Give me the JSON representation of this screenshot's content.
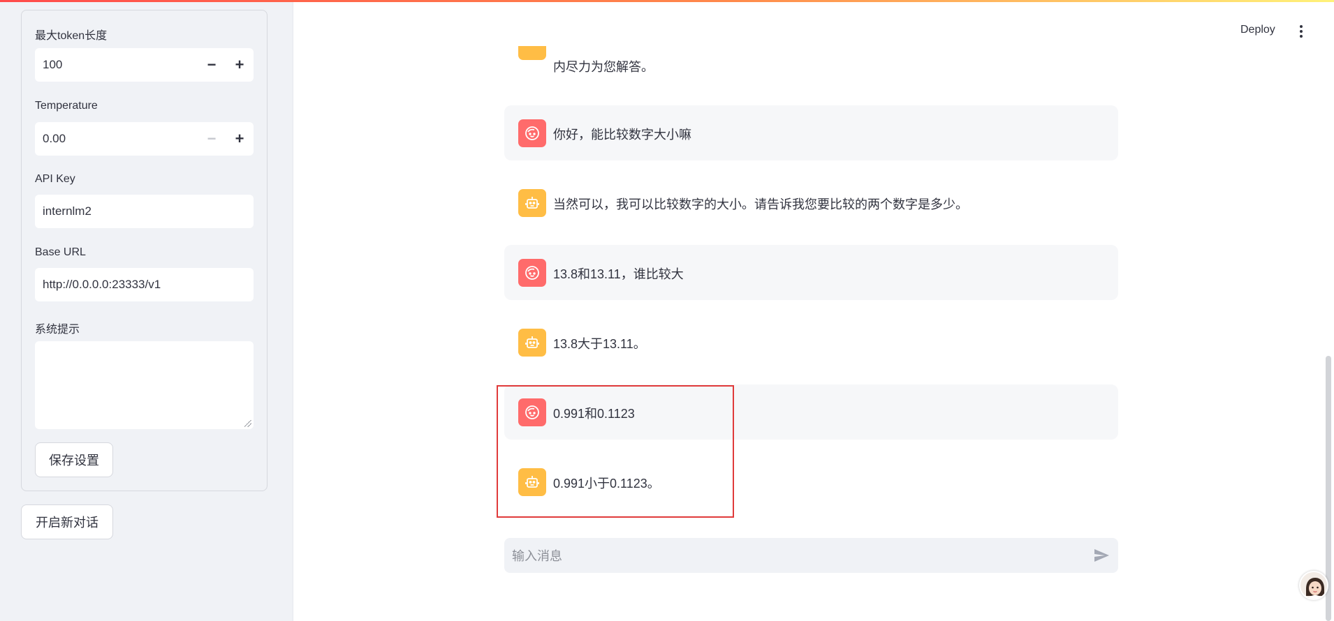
{
  "header": {
    "deploy_label": "Deploy",
    "menu_icon": "kebab-menu-icon"
  },
  "sidebar": {
    "max_tokens": {
      "label": "最大token长度",
      "value": "100"
    },
    "temperature": {
      "label": "Temperature",
      "value": "0.00"
    },
    "api_key": {
      "label": "API Key",
      "value": "internlm2"
    },
    "base_url": {
      "label": "Base URL",
      "value": "http://0.0.0.0:23333/v1"
    },
    "system_prompt": {
      "label": "系统提示",
      "value": ""
    },
    "save_button": "保存设置",
    "new_chat_button": "开启新对话",
    "minus_glyph": "−",
    "plus_glyph": "+"
  },
  "chat": {
    "partial_message": "内尽力为您解答。",
    "messages": [
      {
        "role": "user",
        "text": "你好，能比较数字大小嘛"
      },
      {
        "role": "assistant",
        "text": "当然可以，我可以比较数字的大小。请告诉我您要比较的两个数字是多少。"
      },
      {
        "role": "user",
        "text": "13.8和13.11，谁比较大"
      },
      {
        "role": "assistant",
        "text": "13.8大于13.11。"
      },
      {
        "role": "user",
        "text": "0.991和0.1123"
      },
      {
        "role": "assistant",
        "text": "0.991小于0.1123。"
      }
    ],
    "input_placeholder": "输入消息"
  },
  "colors": {
    "user_avatar": "#ff6b6b",
    "assistant_avatar": "#ffbd45",
    "highlight_box": "#e03a3a"
  }
}
